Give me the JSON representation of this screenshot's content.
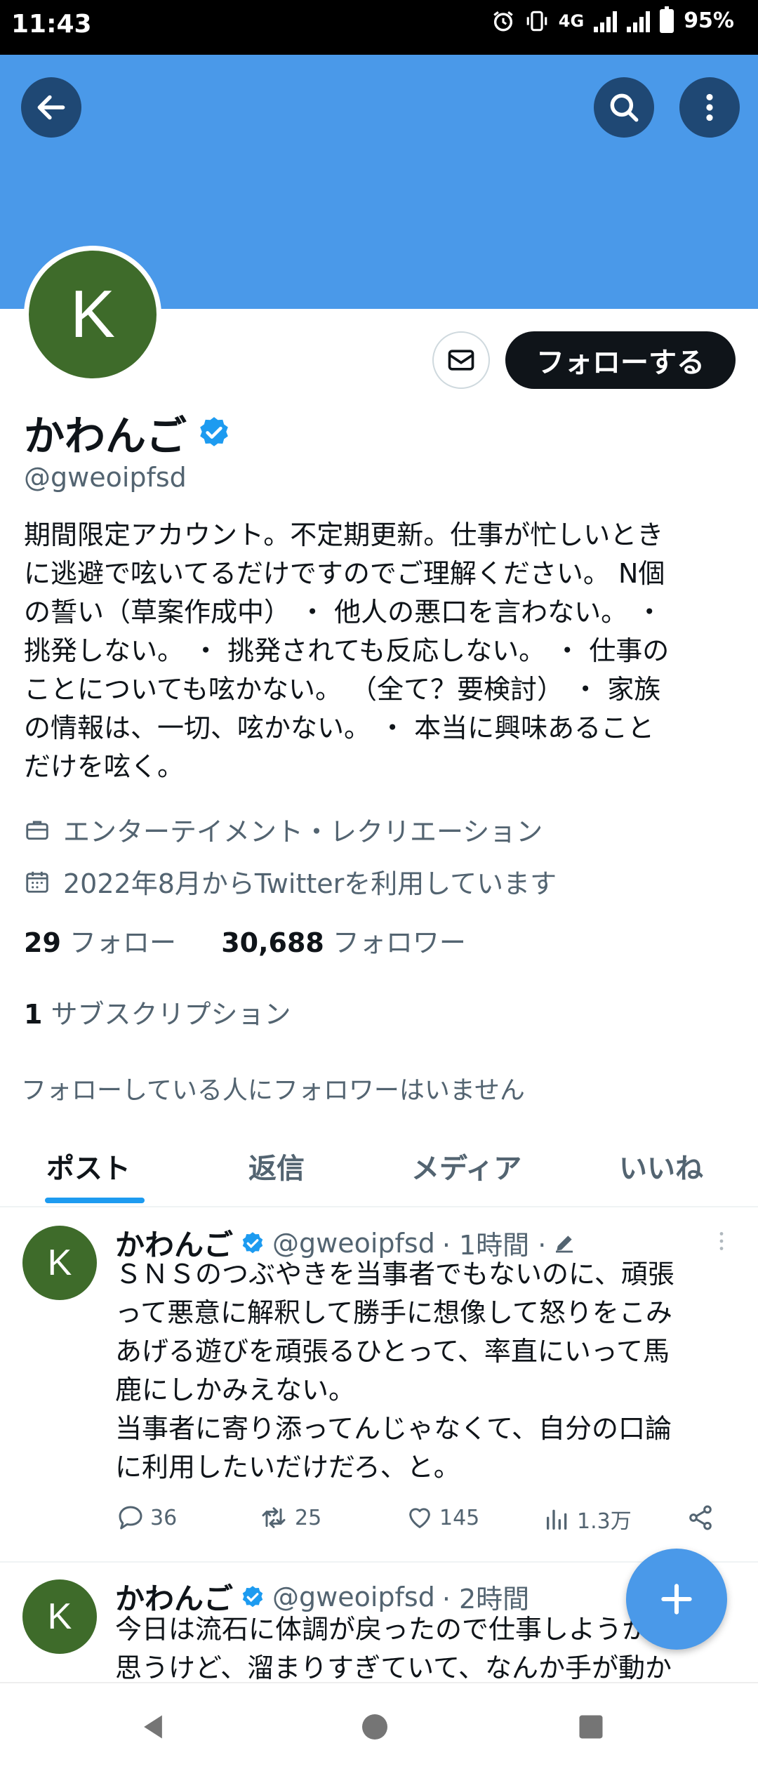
{
  "status_bar": {
    "time": "11:43",
    "network": "4G",
    "battery": "95%"
  },
  "profile": {
    "avatar_letter": "K",
    "name": "かわんご",
    "handle": "@gweoipfsd",
    "follow_label": "フォローする",
    "bio_lines": [
      "期間限定アカウント。不定期更新。仕事が忙しいとき",
      "に逃避で呟いてるだけですのでご理解ください。 N個",
      "の誓い（草案作成中） ・ 他人の悪口を言わない。 ・",
      "挑発しない。 ・ 挑発されても反応しない。 ・ 仕事の",
      "ことについても呟かない。 （全て？要検討） ・ 家族",
      "の情報は、一切、呟かない。 ・ 本当に興味あること",
      "だけを呟く。"
    ],
    "category": "エンターテイメント・レクリエーション",
    "joined": "2022年8月からTwitterを利用しています",
    "following_count": "29",
    "following_label": "フォロー",
    "followers_count": "30,688",
    "followers_label": "フォロワー",
    "subscriptions_count": "1",
    "subscriptions_label": "サブスクリプション",
    "followed_by_note": "フォローしている人にフォロワーはいません"
  },
  "tabs": [
    {
      "label": "ポスト",
      "active": true
    },
    {
      "label": "返信",
      "active": false
    },
    {
      "label": "メディア",
      "active": false
    },
    {
      "label": "いいね",
      "active": false
    }
  ],
  "posts": [
    {
      "avatar_letter": "K",
      "name": "かわんご",
      "handle": "@gweoipfsd",
      "time": "· 1時間 ·",
      "text": "ＳＮＳのつぶやきを当事者でもないのに、頑張\nって悪意に解釈して勝手に想像して怒りをこみ\nあげる遊びを頑張るひとって、率直にいって馬\n鹿にしかみえない。\n当事者に寄り添ってんじゃなくて、自分の口論\nに利用したいだけだろ、と。",
      "replies": "36",
      "reposts": "25",
      "likes": "145",
      "views": "1.3万"
    },
    {
      "avatar_letter": "K",
      "name": "かわんご",
      "handle": "@gweoipfsd",
      "time": "· 2時間",
      "text": "今日は流石に体調が戻ったので仕事しようかと\n思うけど、溜まりすぎていて、なんか手が動か"
    }
  ],
  "colors": {
    "banner": "#4a99e9",
    "avatar": "#3e6b2a",
    "accent": "#1d9bf0",
    "verified": "#1d9bf0"
  }
}
